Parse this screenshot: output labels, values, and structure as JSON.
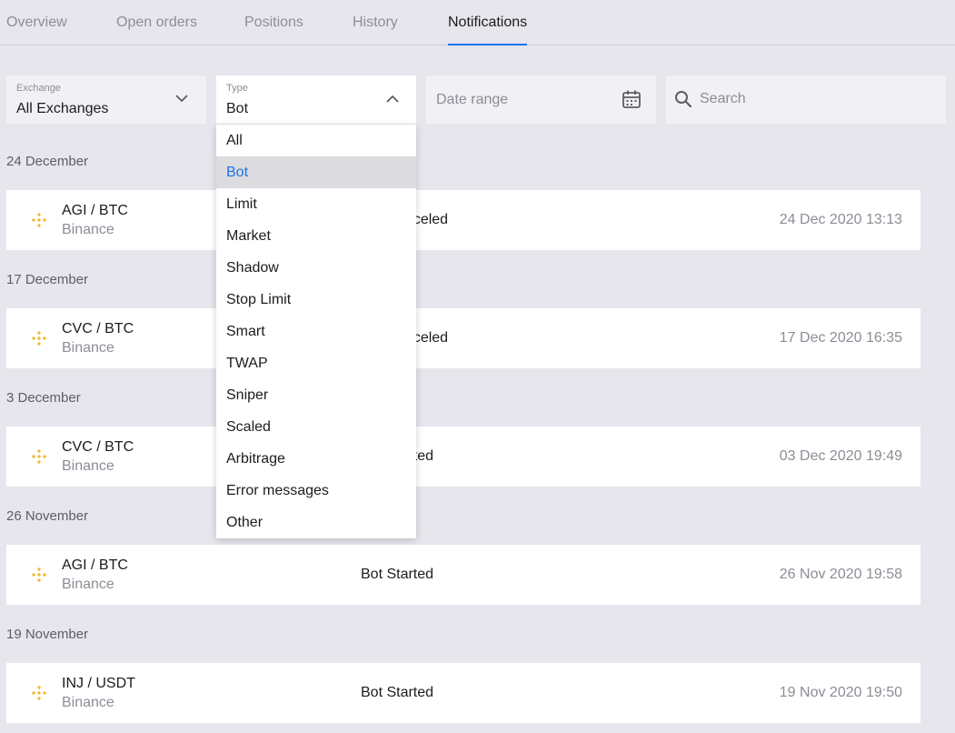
{
  "tabs": [
    {
      "label": "Overview"
    },
    {
      "label": "Open orders"
    },
    {
      "label": "Positions"
    },
    {
      "label": "History"
    },
    {
      "label": "Notifications"
    }
  ],
  "filters": {
    "exchange": {
      "label": "Exchange",
      "value": "All Exchanges"
    },
    "type": {
      "label": "Type",
      "value": "Bot"
    },
    "date_range": {
      "placeholder": "Date range"
    },
    "search": {
      "placeholder": "Search"
    }
  },
  "dropdown": {
    "options": [
      "All",
      "Bot",
      "Limit",
      "Market",
      "Shadow",
      "Stop Limit",
      "Smart",
      "TWAP",
      "Sniper",
      "Scaled",
      "Arbitrage",
      "Error messages",
      "Other"
    ],
    "selected": "Bot"
  },
  "sections": [
    {
      "date": "24 December",
      "row": {
        "pair": "AGI / BTC",
        "exchange": "Binance",
        "status": "Bot Canceled",
        "timestamp": "24 Dec 2020 13:13"
      }
    },
    {
      "date": "17 December",
      "row": {
        "pair": "CVC / BTC",
        "exchange": "Binance",
        "status": "Bot Canceled",
        "timestamp": "17 Dec 2020 16:35"
      }
    },
    {
      "date": "3 December",
      "row": {
        "pair": "CVC / BTC",
        "exchange": "Binance",
        "status": "Bot Started",
        "timestamp": "03 Dec 2020 19:49"
      }
    },
    {
      "date": "26 November",
      "row": {
        "pair": "AGI / BTC",
        "exchange": "Binance",
        "status": "Bot Started",
        "timestamp": "26 Nov 2020 19:58"
      }
    },
    {
      "date": "19 November",
      "row": {
        "pair": "INJ / USDT",
        "exchange": "Binance",
        "status": "Bot Started",
        "timestamp": "19 Nov 2020 19:50"
      }
    }
  ],
  "colors": {
    "accent": "#1a73e8",
    "binance": "#f3ba2f",
    "background": "#e8e6ed"
  },
  "icons": {
    "exchange_chevron": "chevron-down-icon",
    "type_chevron": "chevron-up-icon",
    "date": "calendar-icon",
    "search": "search-icon",
    "coin": "binance-icon"
  }
}
